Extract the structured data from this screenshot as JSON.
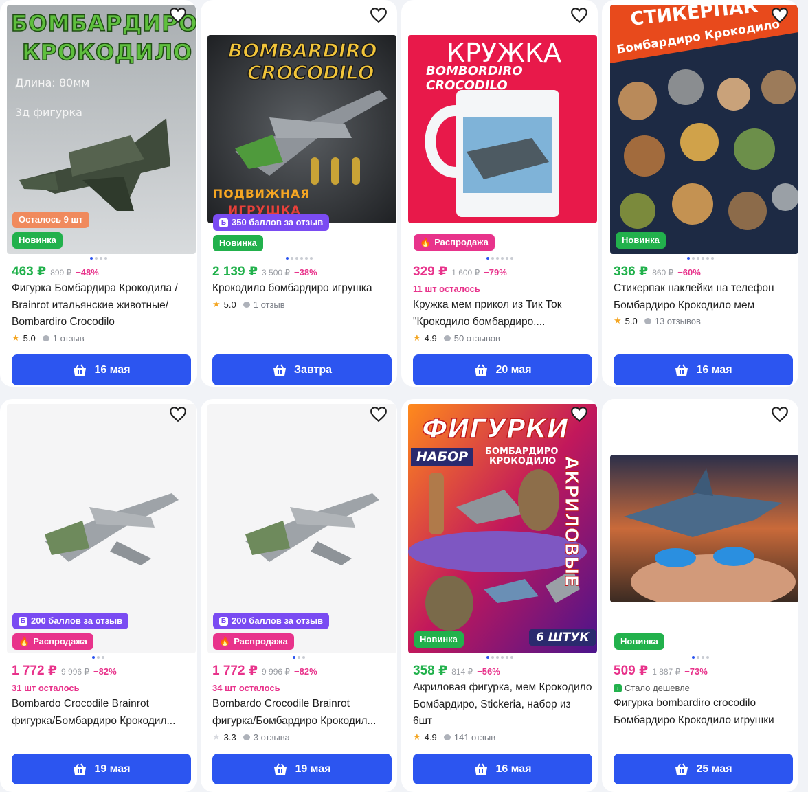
{
  "cards": [
    {
      "image_text": {
        "l1": "БОМБАРДИРО",
        "l2": "КРОКОДИЛО",
        "l3": "Длина: 80мм",
        "l4": "3д фигурка"
      },
      "badges": {
        "b1": "Осталось 9 шт",
        "b2": "Новинка"
      },
      "price": "463 ₽",
      "old_price": "899 ₽",
      "discount": "−48%",
      "title": "Фигурка Бомбардира Крокодила / Brainrot итальянские животные/ Bombardiro Crocodilo",
      "rating": "5.0",
      "reviews": "1 отзыв",
      "delivery": "16 мая"
    },
    {
      "image_text": {
        "l1": "BOMBARDIRO",
        "l2": "CROCODILO",
        "l3": "ПОДВИЖНАЯ",
        "l4": "ИГРУШКА"
      },
      "badges": {
        "b1": "350 баллов за отзыв",
        "b2": "Новинка"
      },
      "price": "2 139 ₽",
      "old_price": "3 500 ₽",
      "discount": "−38%",
      "title": "Крокодило бомбардиро игрушка",
      "rating": "5.0",
      "reviews": "1 отзыв",
      "delivery": "Завтра"
    },
    {
      "image_text": {
        "l1": "КРУЖКА",
        "l2": "BOMBORDIRO CROCODILO"
      },
      "badges": {
        "b1": "Распродажа"
      },
      "price": "329 ₽",
      "old_price": "1 600 ₽",
      "discount": "−79%",
      "stock": "11 шт осталось",
      "title": "Кружка мем прикол из Тик Ток \"Крокодило бомбардиро,...",
      "rating": "4.9",
      "reviews": "50 отзывов",
      "delivery": "20 мая"
    },
    {
      "image_text": {
        "l1": "СТИКЕРПАК",
        "l2": "Бомбардиро Крокодило"
      },
      "badges": {
        "b1": "Новинка"
      },
      "price": "336 ₽",
      "old_price": "860 ₽",
      "discount": "−60%",
      "title": "Стикерпак наклейки на телефон Бомбардиро Крокодило мем",
      "rating": "5.0",
      "reviews": "13 отзывов",
      "delivery": "16 мая"
    },
    {
      "badges": {
        "b1": "200 баллов за отзыв",
        "b2": "Распродажа"
      },
      "price": "1 772 ₽",
      "old_price": "9 996 ₽",
      "discount": "−82%",
      "stock": "31 шт осталось",
      "title": "Bombardo Crocodile Brainrot фигурка/Бомбардиро Крокодил...",
      "delivery": "19 мая"
    },
    {
      "badges": {
        "b1": "200 баллов за отзыв",
        "b2": "Распродажа"
      },
      "price": "1 772 ₽",
      "old_price": "9 996 ₽",
      "discount": "−82%",
      "stock": "34 шт осталось",
      "title": "Bombardo Crocodile Brainrot фигурка/Бомбардиро Крокодил...",
      "rating": "3.3",
      "reviews": "3 отзыва",
      "delivery": "19 мая"
    },
    {
      "image_text": {
        "l1": "ФИГУРКИ",
        "l2": "НАБОР",
        "l3": "БОМБАРДИРО",
        "l4": "КРОКОДИЛО",
        "l5": "АКРИЛОВЫЕ",
        "l6": "6 ШТУК"
      },
      "badges": {
        "b1": "Новинка"
      },
      "price": "358 ₽",
      "old_price": "814 ₽",
      "discount": "−56%",
      "title": "Акриловая фигурка, мем Крокодило Бомбардиро, Stickeria, набор из 6шт",
      "rating": "4.9",
      "reviews": "141 отзыв",
      "delivery": "16 мая"
    },
    {
      "badges": {
        "b1": "Новинка"
      },
      "price": "509 ₽",
      "old_price": "1 887 ₽",
      "discount": "−73%",
      "cheaper": "Стало дешевле",
      "title": "Фигурка bombardiro crocodilo Бомбардиро Крокодило игрушки",
      "delivery": "25 мая"
    }
  ],
  "icons": {
    "favorite": "heart-outline-icon",
    "basket": "basket-icon",
    "star": "star-icon",
    "reviews": "speech-bubble-icon",
    "bonus": "bonus-b-icon",
    "fire": "fire-icon",
    "price_down": "price-down-icon"
  },
  "colors": {
    "accent_blue": "#2c55f0",
    "price_green": "#22b14c",
    "price_pink": "#e8338b",
    "badge_purple": "#7a4bf2",
    "badge_orange": "#f08a5d"
  }
}
